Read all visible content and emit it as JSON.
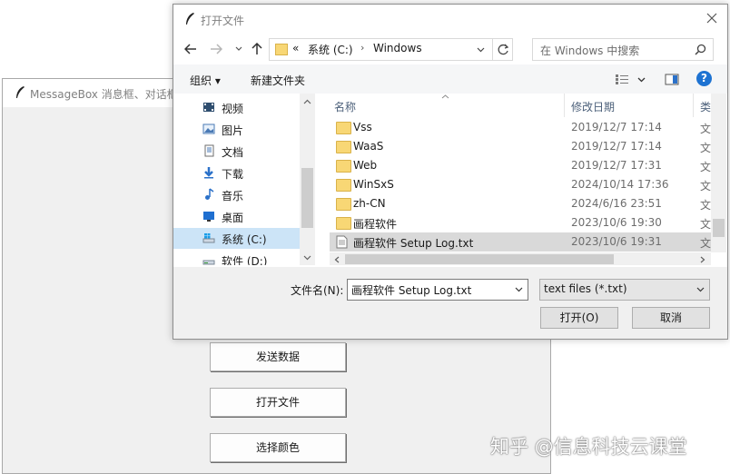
{
  "background_window": {
    "title": "MessageBox 消息框、对话框",
    "buttons": [
      "发送数据",
      "打开文件",
      "选择颜色"
    ]
  },
  "dialog": {
    "title": "打开文件",
    "address": {
      "prefix": "«",
      "path": [
        "系统 (C:)",
        "Windows"
      ]
    },
    "search_placeholder": "在 Windows 中搜索",
    "toolbar": {
      "organize": "组织 ▾",
      "new_folder": "新建文件夹"
    },
    "nav_items": [
      {
        "label": "视频",
        "icon": "video-icon"
      },
      {
        "label": "图片",
        "icon": "pictures-icon"
      },
      {
        "label": "文档",
        "icon": "documents-icon"
      },
      {
        "label": "下载",
        "icon": "download-icon"
      },
      {
        "label": "音乐",
        "icon": "music-icon"
      },
      {
        "label": "桌面",
        "icon": "desktop-icon"
      },
      {
        "label": "系统 (C:)",
        "icon": "drive-c-icon",
        "selected": true
      },
      {
        "label": "软件 (D:)",
        "icon": "drive-d-icon"
      }
    ],
    "columns": {
      "name": "名称",
      "date": "修改日期",
      "type": "类"
    },
    "files": [
      {
        "name": "Vss",
        "date": "2019/12/7 17:14",
        "type": "文",
        "kind": "folder"
      },
      {
        "name": "WaaS",
        "date": "2019/12/7 17:14",
        "type": "文",
        "kind": "folder"
      },
      {
        "name": "Web",
        "date": "2019/12/7 17:31",
        "type": "文",
        "kind": "folder"
      },
      {
        "name": "WinSxS",
        "date": "2024/10/14 17:36",
        "type": "文",
        "kind": "folder"
      },
      {
        "name": "zh-CN",
        "date": "2024/6/16 23:51",
        "type": "文",
        "kind": "folder"
      },
      {
        "name": "画程软件",
        "date": "2023/10/6 19:30",
        "type": "文",
        "kind": "folder"
      },
      {
        "name": "画程软件 Setup Log.txt",
        "date": "2023/10/6 19:31",
        "type": "文",
        "kind": "file",
        "selected": true
      }
    ],
    "filename_label": "文件名(N):",
    "filename_value": "画程软件 Setup Log.txt",
    "filetype": "text files (*.txt)",
    "open_button": "打开(O)",
    "cancel_button": "取消"
  },
  "watermark": "知乎 @信息科技云课堂",
  "colors": {
    "selected_row": "#d9d9d9",
    "folder": "#f8d775",
    "help": "#1e73d2"
  }
}
